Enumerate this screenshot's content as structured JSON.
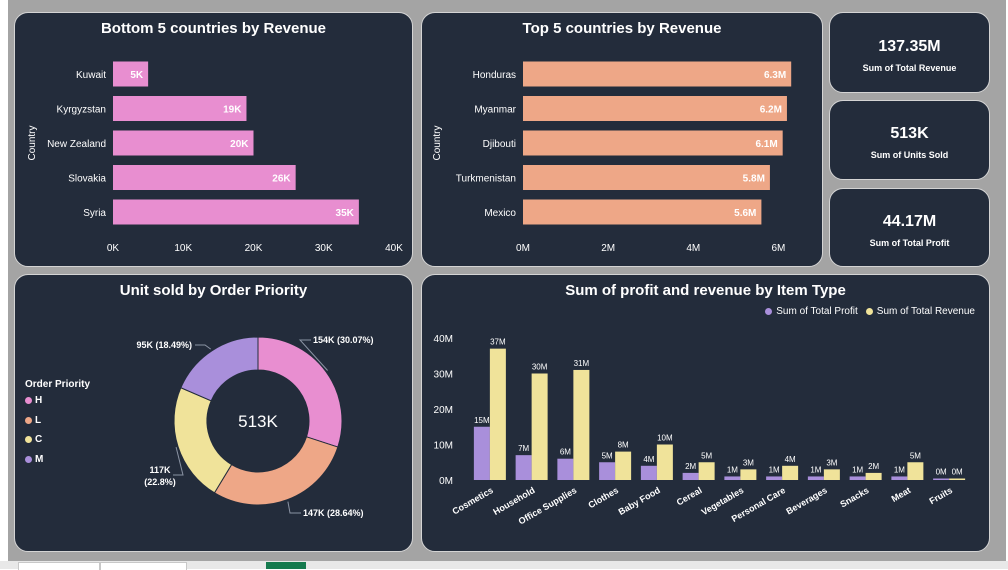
{
  "colors": {
    "background": "#a4a4a4",
    "card": "#232c3b",
    "pink": "#e88ed0",
    "salmon": "#eea787",
    "yellow": "#f0e39a",
    "purple": "#a98fdb",
    "text": "#ffffff"
  },
  "kpis": [
    {
      "value": "137.35M",
      "label": "Sum of Total Revenue"
    },
    {
      "value": "513K",
      "label": "Sum of Units Sold"
    },
    {
      "value": "44.17M",
      "label": "Sum of Total Profit"
    }
  ],
  "chart_data": [
    {
      "type": "bar",
      "orientation": "horizontal",
      "title": "Bottom 5 countries by Revenue",
      "ylabel": "Country",
      "xlabel": "",
      "categories": [
        "Kuwait",
        "Kyrgyzstan",
        "New Zealand",
        "Slovakia",
        "Syria"
      ],
      "values": [
        5000,
        19000,
        20000,
        26000,
        35000
      ],
      "data_labels": [
        "5K",
        "19K",
        "20K",
        "26K",
        "35K"
      ],
      "xlim": [
        0,
        40000
      ],
      "xticks": [
        0,
        10000,
        20000,
        30000,
        40000
      ],
      "xtick_labels": [
        "0K",
        "10K",
        "20K",
        "30K",
        "40K"
      ],
      "color": "#e88ed0"
    },
    {
      "type": "bar",
      "orientation": "horizontal",
      "title": "Top 5 countries by Revenue",
      "ylabel": "Country",
      "xlabel": "",
      "categories": [
        "Honduras",
        "Myanmar",
        "Djibouti",
        "Turkmenistan",
        "Mexico"
      ],
      "values": [
        6300000,
        6200000,
        6100000,
        5800000,
        5600000
      ],
      "data_labels": [
        "6.3M",
        "6.2M",
        "6.1M",
        "5.8M",
        "5.6M"
      ],
      "xlim": [
        0,
        7000000
      ],
      "xticks": [
        0,
        2000000,
        4000000,
        6000000
      ],
      "xtick_labels": [
        "0M",
        "2M",
        "4M",
        "6M"
      ],
      "color": "#eea787"
    },
    {
      "type": "pie",
      "subtype": "donut",
      "title": "Unit sold by Order Priority",
      "center_label": "513K",
      "legend_title": "Order Priority",
      "legend_position": "left",
      "legend": [
        {
          "name": "H",
          "color": "#e88ed0"
        },
        {
          "name": "L",
          "color": "#eea787"
        },
        {
          "name": "C",
          "color": "#f0e39a"
        },
        {
          "name": "M",
          "color": "#a98fdb"
        }
      ],
      "slices": [
        {
          "name": "H",
          "value": 154000,
          "percent": 30.07,
          "label": "154K (30.07%)",
          "color": "#e88ed0"
        },
        {
          "name": "L",
          "value": 147000,
          "percent": 28.64,
          "label": "147K (28.64%)",
          "color": "#eea787"
        },
        {
          "name": "C",
          "value": 117000,
          "percent": 22.8,
          "label": "117K (22.8%)",
          "label_lines": [
            "117K",
            "(22.8%)"
          ],
          "color": "#f0e39a"
        },
        {
          "name": "M",
          "value": 95000,
          "percent": 18.49,
          "label": "95K (18.49%)",
          "color": "#a98fdb"
        }
      ]
    },
    {
      "type": "bar",
      "orientation": "vertical",
      "title": "Sum of profit and revenue by Item Type",
      "legend_position": "top-right",
      "categories": [
        "Cosmetics",
        "Household",
        "Office Supplies",
        "Clothes",
        "Baby Food",
        "Cereal",
        "Vegetables",
        "Personal Care",
        "Beverages",
        "Snacks",
        "Meat",
        "Fruits"
      ],
      "series": [
        {
          "name": "Sum of Total Profit",
          "color": "#a98fdb",
          "values": [
            15,
            7,
            6,
            5,
            4,
            2,
            1,
            1,
            1,
            1,
            1,
            0
          ],
          "labels": [
            "15M",
            "7M",
            "6M",
            "5M",
            "4M",
            "2M",
            "1M",
            "1M",
            "1M",
            "1M",
            "1M",
            "0M"
          ]
        },
        {
          "name": "Sum of Total Revenue",
          "color": "#f0e39a",
          "values": [
            37,
            30,
            31,
            8,
            10,
            5,
            3,
            4,
            3,
            2,
            5,
            0
          ],
          "labels": [
            "37M",
            "30M",
            "31M",
            "8M",
            "10M",
            "5M",
            "3M",
            "4M",
            "3M",
            "2M",
            "5M",
            "0M"
          ]
        }
      ],
      "unit": "M",
      "ylim": [
        0,
        40
      ],
      "yticks": [
        0,
        10,
        20,
        30,
        40
      ],
      "ytick_labels": [
        "0M",
        "10M",
        "20M",
        "30M",
        "40M"
      ]
    }
  ]
}
